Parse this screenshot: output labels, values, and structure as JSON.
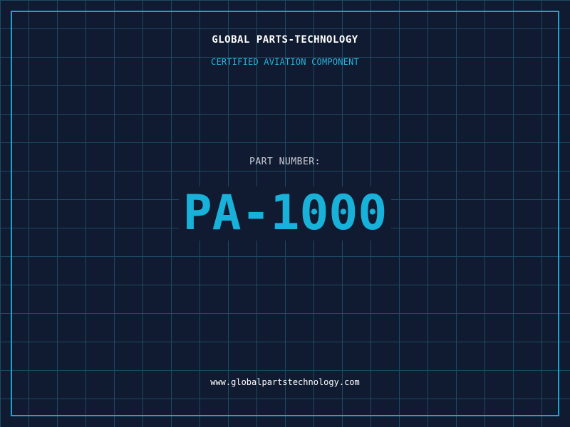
{
  "brand": {
    "title": "GLOBAL PARTS-TECHNOLOGY",
    "subtitle": "CERTIFIED AVIATION COMPONENT"
  },
  "part": {
    "label": "PART NUMBER:",
    "number": "PA-1000"
  },
  "footer": {
    "website": "www.globalpartstechnology.com"
  },
  "colors": {
    "background": "#101a30",
    "grid": "#1d4b64",
    "accent": "#19a4d4",
    "text": "#ffffff",
    "muted": "#c8ccd6"
  }
}
